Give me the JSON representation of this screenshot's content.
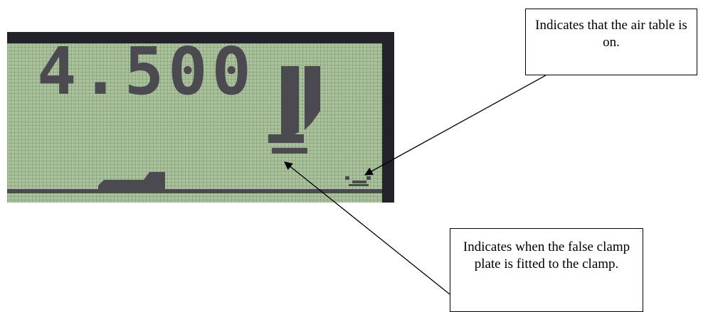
{
  "display": {
    "readout": "4.500"
  },
  "callouts": {
    "air_table": "Indicates that the air table is on.",
    "false_clamp": "Indicates when the false clamp plate is fitted to the clamp."
  },
  "colors": {
    "lcd_background": "#a9c29b",
    "lcd_pixels": "#4a4a50",
    "bezel": "#23212a"
  },
  "icons": {
    "clamp": "clamp-icon",
    "false_clamp_plate": "false-clamp-plate-icon",
    "air_table": "air-table-icon",
    "table_profile": "table-profile-icon"
  }
}
